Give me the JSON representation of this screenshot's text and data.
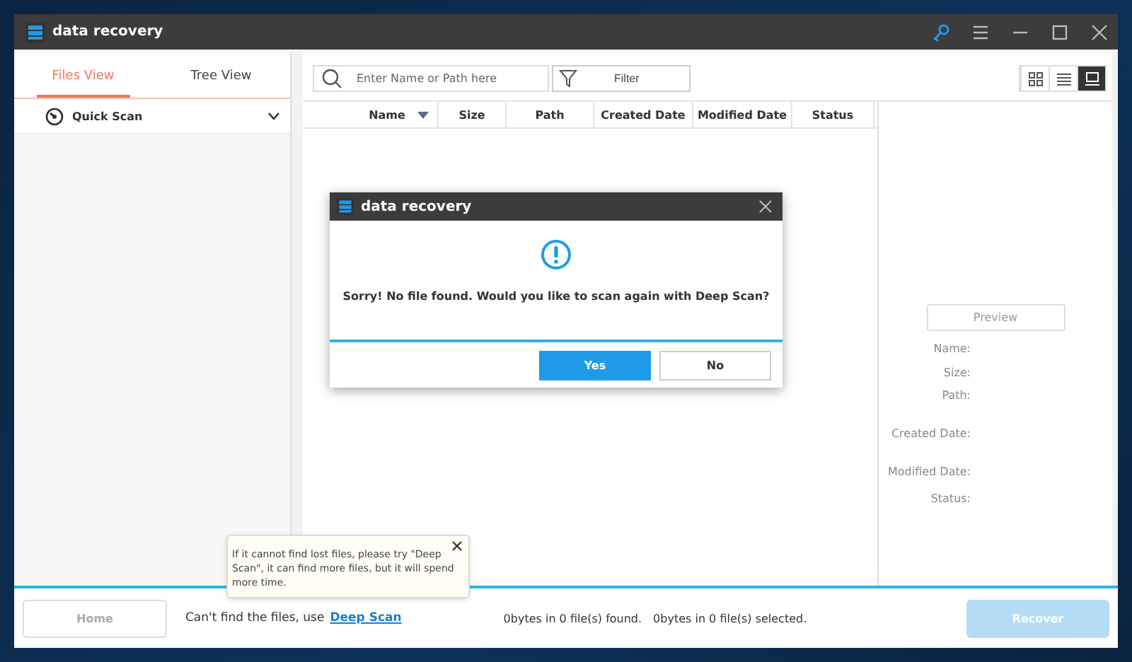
{
  "window": {
    "title": "data recovery"
  },
  "sidebar": {
    "tabs": [
      {
        "label": "Files View",
        "selected": true
      },
      {
        "label": "Tree View",
        "selected": false
      }
    ],
    "items": [
      {
        "label": "Quick Scan",
        "expanded": false
      }
    ]
  },
  "search": {
    "placeholder": "Enter Name or Path here"
  },
  "filter": {
    "label": "Filter"
  },
  "view_buttons": [
    {
      "kind": "grid",
      "selected": false
    },
    {
      "kind": "list",
      "selected": false
    },
    {
      "kind": "detail",
      "selected": true
    }
  ],
  "table": {
    "columns": [
      {
        "label": "Name",
        "sorted": true
      },
      {
        "label": "Size",
        "sorted": false
      },
      {
        "label": "Path",
        "sorted": false
      },
      {
        "label": "Created Date",
        "sorted": false
      },
      {
        "label": "Modified Date",
        "sorted": false
      },
      {
        "label": "Status",
        "sorted": false
      }
    ]
  },
  "details": {
    "preview_button": {
      "label": "Preview",
      "disabled": true
    },
    "fields": [
      "Name:",
      "Size:",
      "Path:",
      "Created Date:",
      "Modified Date:",
      "Status:"
    ]
  },
  "dialog": {
    "title": "data recovery",
    "message": "Sorry! No file found. Would you like to scan again with Deep Scan?",
    "buttons": [
      {
        "label": "Yes",
        "primary": true
      },
      {
        "label": "No",
        "primary": false
      }
    ]
  },
  "tooltip": {
    "text": "If it cannot find lost files, please try \"Deep Scan\", it can find more files, but it will spend more time."
  },
  "footer": {
    "home_button": {
      "label": "Home",
      "disabled": true
    },
    "hint": "Can't find the files, use",
    "link": "Deep Scan",
    "found": "0bytes in 0 file(s) found.",
    "selected": "0bytes in 0 file(s) selected.",
    "recover_button": {
      "label": "Recover",
      "disabled": true
    }
  }
}
